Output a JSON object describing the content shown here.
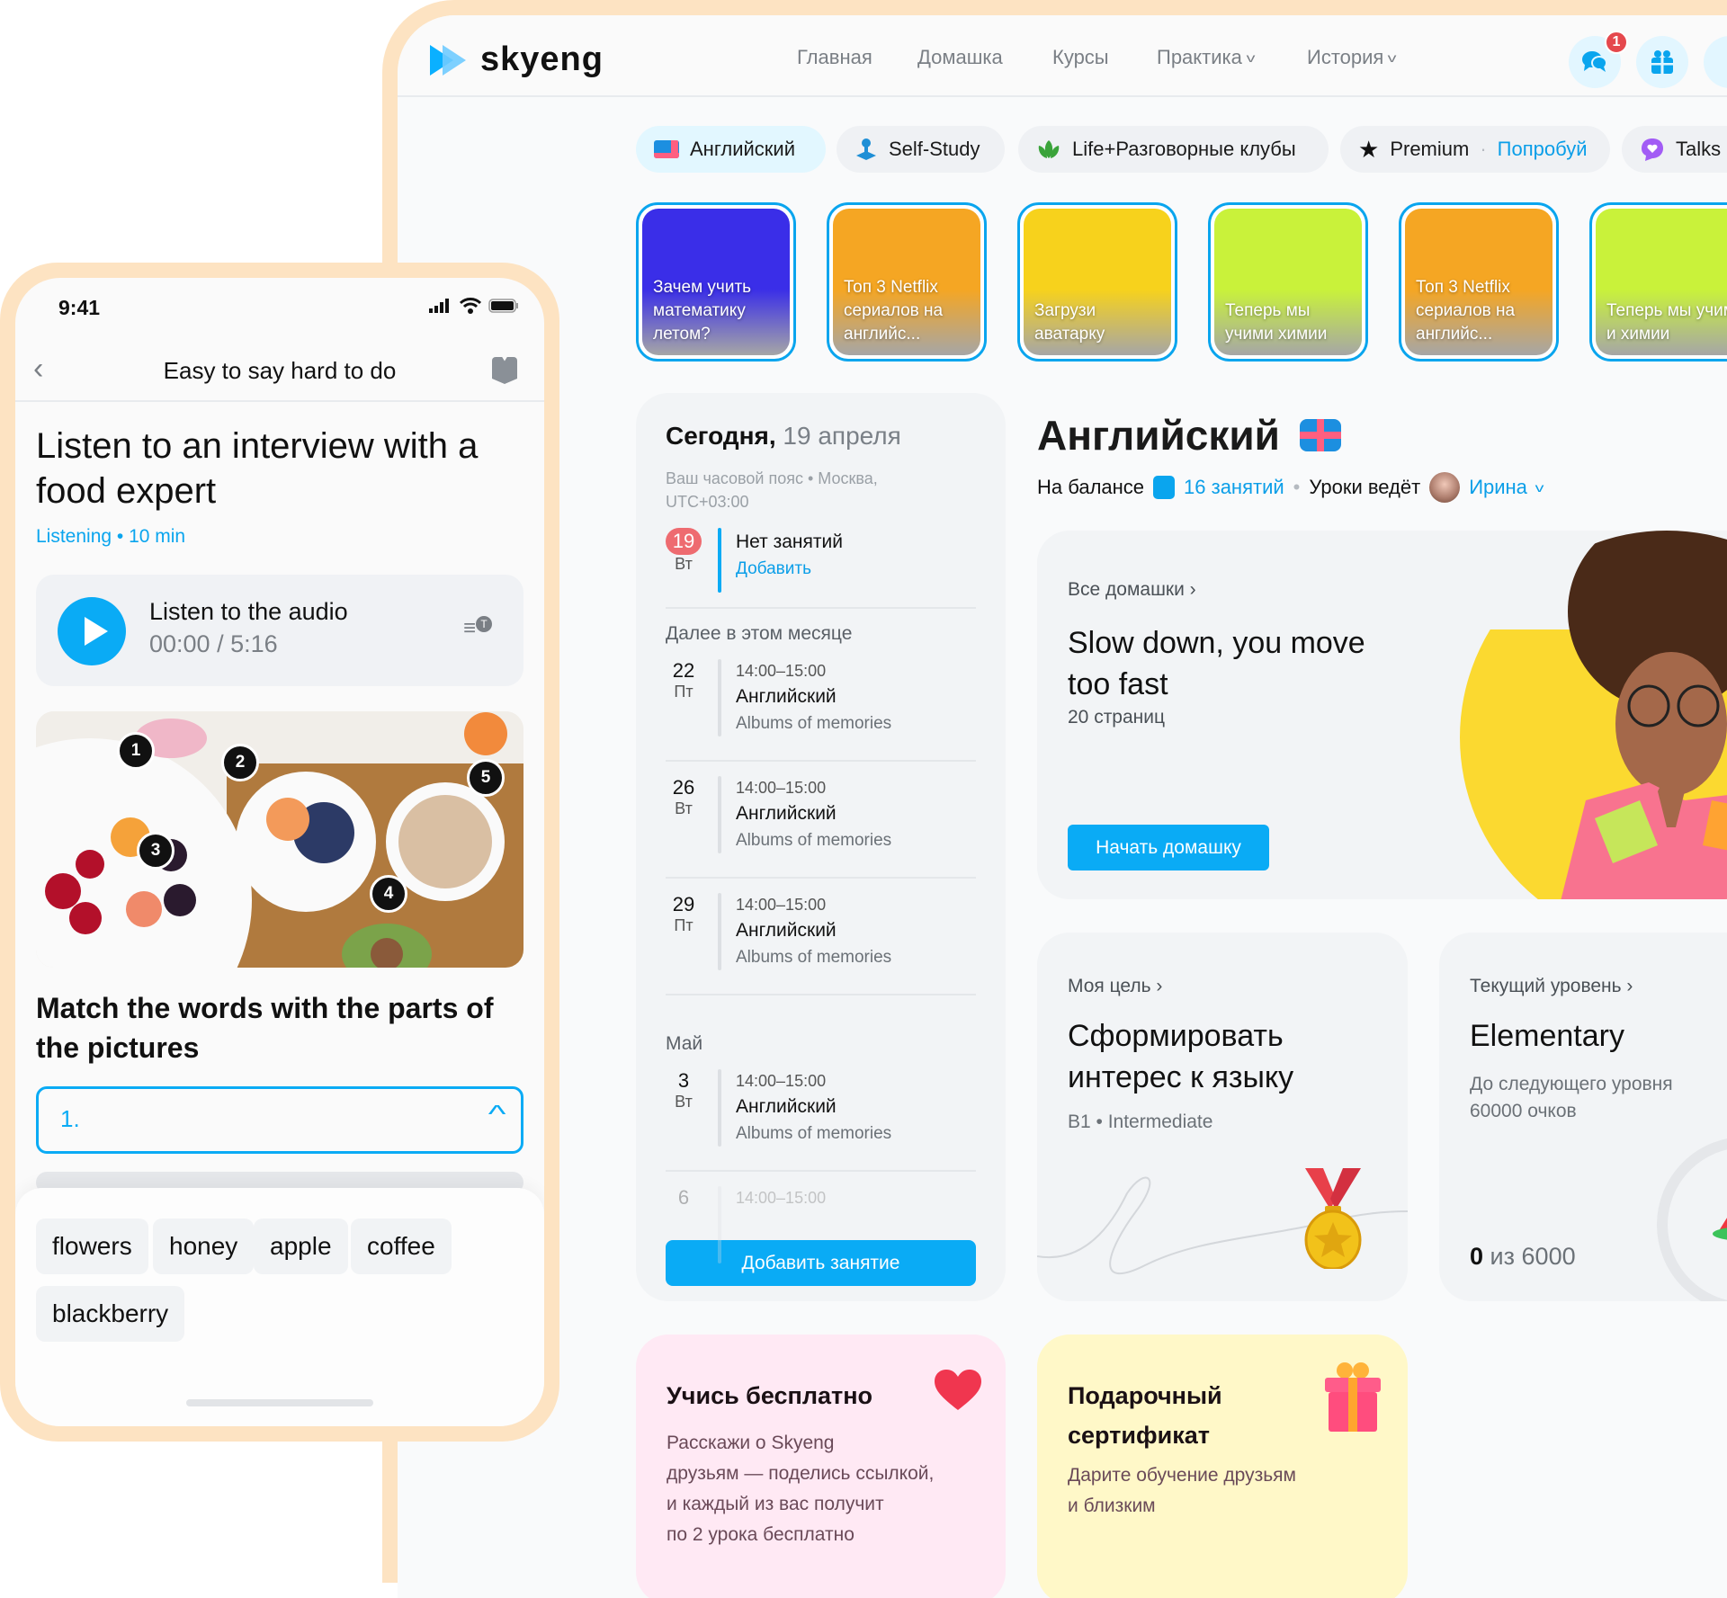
{
  "desktop": {
    "logo": "skyeng",
    "nav": [
      {
        "label": "Главная",
        "dropdown": false
      },
      {
        "label": "Домашка",
        "dropdown": false
      },
      {
        "label": "Курсы",
        "dropdown": false
      },
      {
        "label": "Практика",
        "dropdown": true
      },
      {
        "label": "История",
        "dropdown": true
      }
    ],
    "header_icons": [
      {
        "icon": "chat-icon",
        "badge": "1"
      },
      {
        "icon": "gift-icon",
        "badge": null
      }
    ],
    "pills": [
      {
        "label": "Английский",
        "icon": "uk-flag-icon",
        "active": true
      },
      {
        "label": "Self-Study",
        "icon": "joystick-icon",
        "active": false
      },
      {
        "label": "Life+Разговорные клубы",
        "icon": "leaf-icon",
        "active": false
      },
      {
        "label": "Premium",
        "sep": "·",
        "cta": "Попробуй",
        "icon": "star-icon",
        "active": false
      },
      {
        "label": "Talks",
        "icon": "talks-heart-icon",
        "active": false
      }
    ],
    "stories": [
      {
        "caption": "Зачем учить математику летом?",
        "color": "#3a2ee8"
      },
      {
        "caption": "Топ 3 Netflix сериалов на английс...",
        "color": "#f5a623"
      },
      {
        "caption": "Загрузи аватарку",
        "color": "#f7d21c"
      },
      {
        "caption": "Теперь мы учими химии",
        "color": "#c9f23a"
      },
      {
        "caption": "Топ 3 Netflix сериалов на английс...",
        "color": "#f5a623"
      },
      {
        "caption": "Теперь мы учим и химии",
        "color": "#c9f23a"
      }
    ],
    "schedule": {
      "today_label": "Сегодня,",
      "today_date": "19 апреля",
      "timezone": "Ваш часовой пояс • Москва, UTC+03:00",
      "today": {
        "num": "19",
        "dow": "Вт",
        "text": "Нет занятий",
        "action": "Добавить"
      },
      "section_month": "Далее в этом месяце",
      "month_lessons": [
        {
          "num": "22",
          "dow": "Пт",
          "time": "14:00–15:00",
          "subject": "Английский",
          "topic": "Albums of memories"
        },
        {
          "num": "26",
          "dow": "Вт",
          "time": "14:00–15:00",
          "subject": "Английский",
          "topic": "Albums of memories"
        },
        {
          "num": "29",
          "dow": "Пт",
          "time": "14:00–15:00",
          "subject": "Английский",
          "topic": "Albums of memories"
        }
      ],
      "section_may": "Май",
      "may_lessons": [
        {
          "num": "3",
          "dow": "Вт",
          "time": "14:00–15:00",
          "subject": "Английский",
          "topic": "Albums of memories"
        },
        {
          "num": "6",
          "dow": "",
          "time": "14:00–15:00",
          "subject": "",
          "topic": ""
        }
      ],
      "add_button": "Добавить занятие"
    },
    "english": {
      "title": "Английский",
      "balance_label": "На балансе",
      "balance_value": "16 занятий",
      "teacher_label": "Уроки ведёт",
      "teacher_name": "Ирина"
    },
    "homework": {
      "link": "Все домашки ›",
      "title": "Slow down, you move too fast",
      "pages": "20 страниц",
      "button": "Начать домашку"
    },
    "goal": {
      "link": "Моя цель ›",
      "title": "Сформировать интерес к языку",
      "level": "B1 • Intermediate"
    },
    "current_level": {
      "link": "Текущий уровень ›",
      "title": "Elementary",
      "next_label": "До следующего уровня",
      "next_points": "60000 очков",
      "progress_current": "0",
      "progress_sep": "из",
      "progress_total": "6000"
    },
    "promo_free": {
      "title": "Учись бесплатно",
      "text": [
        "Расскажи о Skyeng",
        "друзьям — поделись ссылкой,",
        "и каждый из вас получит",
        "по 2 урока бесплатно"
      ]
    },
    "promo_gift": {
      "title": "Подарочный сертификат",
      "text": [
        "Дарите обучение друзьям",
        "и близким"
      ]
    }
  },
  "phone": {
    "time": "9:41",
    "nav_title": "Easy to say hard to do",
    "heading": "Listen to an interview with a food expert",
    "meta": "Listening • 10 min",
    "audio": {
      "title": "Listen to the audio",
      "time": "00:00 / 5:16"
    },
    "markers": [
      "1",
      "2",
      "3",
      "4",
      "5"
    ],
    "task": "Match the words with the parts of the pictures",
    "select_value": "1.",
    "words": [
      "flowers",
      "honey",
      "apple",
      "coffee",
      "blackberry"
    ]
  },
  "colors": {
    "accent": "#0aabf5",
    "frame": "#fde3c2",
    "badge": "#e5484d"
  }
}
